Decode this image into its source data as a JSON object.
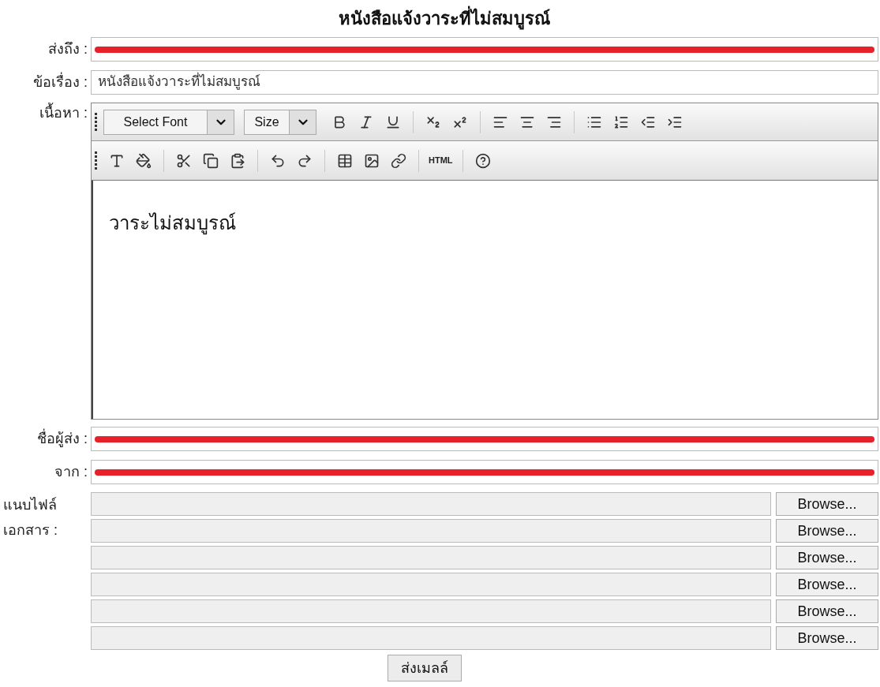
{
  "title": "หนังสือแจ้งวาระที่ไม่สมบูรณ์",
  "top_fields": [
    {
      "label": "ส่งถึง :",
      "redacted": true
    },
    {
      "label": "ข้อเรื่อง :",
      "value": "หนังสือแจ้งวาระที่ไม่สมบูรณ์",
      "redacted": false
    }
  ],
  "editor": {
    "label": "เนื้อหา :",
    "font_select": "Select Font",
    "size_select": "Size",
    "html_button": "HTML",
    "body": "วาระไม่สมบูรณ์"
  },
  "bottom_fields": [
    {
      "label": "ชื่อผู้ส่ง :",
      "redacted": true
    },
    {
      "label": "จาก :",
      "redacted": true
    }
  ],
  "attachments": {
    "label_lines": [
      "แนบไฟล์",
      "เอกสาร :"
    ],
    "browse_buttons": [
      "Browse...",
      "Browse...",
      "Browse...",
      "Browse...",
      "Browse...",
      "Browse..."
    ]
  },
  "submit": "ส่งเมลล์"
}
